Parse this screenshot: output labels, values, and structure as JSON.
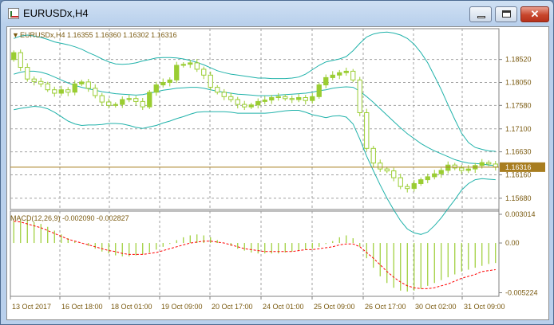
{
  "window": {
    "title": "EURUSDx,H4",
    "icon": "chart-window-icon",
    "buttons": {
      "minimize": "minimize-icon",
      "maximize": "maximize-icon",
      "close": "close-icon"
    }
  },
  "chart_data": [
    {
      "type": "candlestick",
      "info_label": "EURUSDx,H4  1.16355 1.16360 1.16302 1.16316",
      "current_price": "1.16316",
      "current_price_value": 1.16316,
      "ylim": [
        1.1545,
        1.1915
      ],
      "y_ticks": [
        "1.18520",
        "1.18050",
        "1.17580",
        "1.17100",
        "1.16630",
        "1.16160",
        "1.15680"
      ],
      "x_ticks": [
        "13 Oct 2017",
        "16 Oct 18:00",
        "18 Oct 01:00",
        "19 Oct 09:00",
        "20 Oct 17:00",
        "24 Oct 01:00",
        "25 Oct 09:00",
        "26 Oct 17:00",
        "30 Oct 02:00",
        "31 Oct 09:00"
      ],
      "close": [
        1.1866,
        1.1836,
        1.1812,
        1.1807,
        1.1802,
        1.179,
        1.1783,
        1.179,
        1.1785,
        1.1802,
        1.1806,
        1.1793,
        1.1778,
        1.1765,
        1.1758,
        1.176,
        1.177,
        1.1772,
        1.1766,
        1.1755,
        1.1785,
        1.18,
        1.1805,
        1.181,
        1.184,
        1.1842,
        1.1845,
        1.1832,
        1.182,
        1.1795,
        1.1785,
        1.1776,
        1.177,
        1.176,
        1.1755,
        1.1759,
        1.1766,
        1.1769,
        1.1774,
        1.1776,
        1.1772,
        1.177,
        1.1774,
        1.1768,
        1.1776,
        1.18,
        1.1815,
        1.182,
        1.1825,
        1.1828,
        1.181,
        1.1743,
        1.167,
        1.164,
        1.1628,
        1.1624,
        1.161,
        1.1592,
        1.1588,
        1.1598,
        1.1606,
        1.1612,
        1.1618,
        1.1625,
        1.1636,
        1.163,
        1.1625,
        1.1628,
        1.1635,
        1.1641,
        1.1638,
        1.1632
      ],
      "ohlc_note": "",
      "bollinger": {
        "middle": [
          1.1822,
          1.1826,
          1.1828,
          1.1828,
          1.1826,
          1.1822,
          1.1816,
          1.181,
          1.1804,
          1.1799,
          1.1795,
          1.1792,
          1.1789,
          1.1786,
          1.1784,
          1.1782,
          1.1781,
          1.178,
          1.1779,
          1.178,
          1.1783,
          1.1786,
          1.1789,
          1.1791,
          1.1793,
          1.1794,
          1.1795,
          1.1795,
          1.1793,
          1.179,
          1.1787,
          1.1785,
          1.1783,
          1.1781,
          1.178,
          1.1779,
          1.1778,
          1.1778,
          1.1778,
          1.1779,
          1.178,
          1.1781,
          1.1782,
          1.1783,
          1.1785,
          1.1788,
          1.179,
          1.1793,
          1.1795,
          1.1796,
          1.1795,
          1.1787,
          1.1776,
          1.1764,
          1.1751,
          1.1738,
          1.1725,
          1.1712,
          1.17,
          1.169,
          1.168,
          1.1672,
          1.1665,
          1.1659,
          1.1653,
          1.1647,
          1.1643,
          1.164,
          1.1639,
          1.1638,
          1.1636,
          1.1635
        ],
        "upper": [
          1.1895,
          1.19,
          1.1902,
          1.19,
          1.1897,
          1.1893,
          1.1888,
          1.1885,
          1.1882,
          1.1878,
          1.1873,
          1.1866,
          1.186,
          1.1853,
          1.1847,
          1.1843,
          1.1842,
          1.1843,
          1.1845,
          1.1849,
          1.1852,
          1.1855,
          1.1856,
          1.1856,
          1.1855,
          1.1853,
          1.185,
          1.1846,
          1.1841,
          1.1835,
          1.1829,
          1.1825,
          1.1822,
          1.182,
          1.1818,
          1.1816,
          1.1814,
          1.1814,
          1.1813,
          1.1813,
          1.1813,
          1.1814,
          1.1816,
          1.1822,
          1.1831,
          1.184,
          1.1847,
          1.185,
          1.1853,
          1.1858,
          1.187,
          1.1885,
          1.1898,
          1.1904,
          1.1907,
          1.1908,
          1.1906,
          1.1902,
          1.1895,
          1.1883,
          1.1866,
          1.1845,
          1.1818,
          1.179,
          1.1759,
          1.1729,
          1.1701,
          1.1682,
          1.1672,
          1.1668,
          1.1665,
          1.1664
        ],
        "lower": [
          1.1749,
          1.1752,
          1.1754,
          1.1756,
          1.1755,
          1.1751,
          1.1744,
          1.1735,
          1.1726,
          1.172,
          1.1717,
          1.1718,
          1.1718,
          1.1719,
          1.1721,
          1.1721,
          1.172,
          1.1717,
          1.1713,
          1.1711,
          1.1714,
          1.1717,
          1.1722,
          1.1726,
          1.1731,
          1.1735,
          1.174,
          1.1744,
          1.1745,
          1.1745,
          1.1745,
          1.1745,
          1.1744,
          1.1742,
          1.1742,
          1.1742,
          1.1742,
          1.1742,
          1.1743,
          1.1745,
          1.1747,
          1.1748,
          1.1748,
          1.1744,
          1.1739,
          1.1736,
          1.1733,
          1.1736,
          1.1737,
          1.1734,
          1.172,
          1.1689,
          1.1654,
          1.1624,
          1.1595,
          1.1568,
          1.1544,
          1.1522,
          1.1505,
          1.1497,
          1.1494,
          1.1499,
          1.1512,
          1.1528,
          1.1547,
          1.1565,
          1.1585,
          1.1598,
          1.1606,
          1.1608,
          1.1607,
          1.1606
        ]
      }
    },
    {
      "type": "histogram",
      "info_label": "MACD(12,26,9) -0.002090 -0.002827",
      "ylim": [
        -0.0056,
        0.00335
      ],
      "y_ticks": [
        "0.003014",
        "0.00",
        "-0.005224"
      ],
      "histogram": [
        0.0023,
        0.0024,
        0.0024,
        0.0022,
        0.002,
        0.0017,
        0.0013,
        0.0009,
        0.0005,
        0.0002,
        0.0,
        -0.0003,
        -0.0006,
        -0.0009,
        -0.0011,
        -0.0013,
        -0.0014,
        -0.0014,
        -0.0013,
        -0.0012,
        -0.001,
        -0.0007,
        -0.0004,
        -0.0001,
        0.0003,
        0.0006,
        0.0008,
        0.0009,
        0.0008,
        0.0006,
        0.0003,
        0.0,
        -0.0003,
        -0.0006,
        -0.0008,
        -0.001,
        -0.0011,
        -0.0011,
        -0.0011,
        -0.0011,
        -0.001,
        -0.0009,
        -0.0008,
        -0.0007,
        -0.0006,
        -0.0004,
        -0.0001,
        0.0002,
        0.0006,
        0.0008,
        0.0005,
        -0.0004,
        -0.0016,
        -0.0026,
        -0.0035,
        -0.0042,
        -0.0047,
        -0.005,
        -0.0051,
        -0.005,
        -0.0048,
        -0.0045,
        -0.0042,
        -0.0039,
        -0.0036,
        -0.0033,
        -0.003,
        -0.0028,
        -0.0026,
        -0.0024,
        -0.0022,
        -0.0021
      ],
      "signal": [
        0.0023,
        0.0022,
        0.002,
        0.0018,
        0.0016,
        0.0013,
        0.001,
        0.0007,
        0.0004,
        0.0002,
        0.0,
        -0.0002,
        -0.0004,
        -0.0006,
        -0.0008,
        -0.0009,
        -0.0011,
        -0.0012,
        -0.0012,
        -0.0012,
        -0.0011,
        -0.001,
        -0.0008,
        -0.0006,
        -0.0004,
        -0.0002,
        0.0,
        0.0001,
        0.0002,
        0.0002,
        0.0001,
        0.0,
        -0.0002,
        -0.0004,
        -0.0006,
        -0.0007,
        -0.0008,
        -0.0009,
        -0.0009,
        -0.0009,
        -0.0009,
        -0.0009,
        -0.0008,
        -0.0007,
        -0.0007,
        -0.0006,
        -0.0005,
        -0.0004,
        -0.0002,
        -0.0001,
        -0.0001,
        -0.0004,
        -0.001,
        -0.0016,
        -0.0023,
        -0.003,
        -0.0036,
        -0.0041,
        -0.0045,
        -0.0047,
        -0.0048,
        -0.0048,
        -0.0047,
        -0.0045,
        -0.0043,
        -0.004,
        -0.0037,
        -0.0035,
        -0.0033,
        -0.003,
        -0.0029,
        -0.0028
      ]
    }
  ],
  "colors": {
    "up_candle": "#9acd32",
    "down_candle": "#ffffff",
    "candle_outline": "#9acd32",
    "bollinger": "#20b2aa",
    "grid": "#a0a0a0",
    "axis_text": "#7a5a10",
    "macd_histogram": "#9acd32",
    "macd_signal": "#ff0000",
    "price_line": "#a87d1f"
  }
}
